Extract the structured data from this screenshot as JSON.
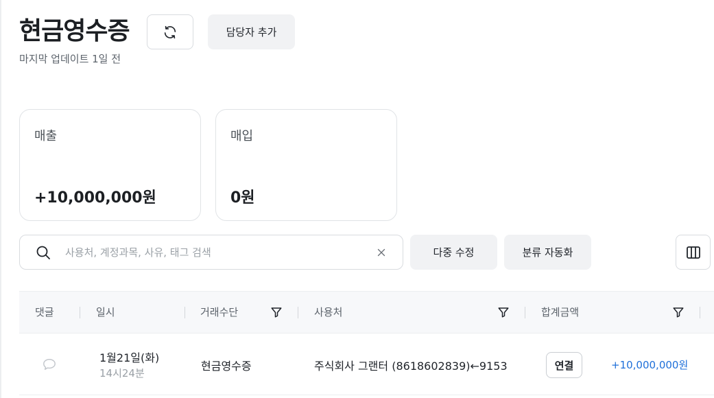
{
  "header": {
    "title": "현금영수증",
    "assign_label": "담당자 추가",
    "last_update": "마지막 업데이트 1일 전"
  },
  "summary": {
    "sales_label": "매출",
    "sales_value": "+10,000,000원",
    "purchase_label": "매입",
    "purchase_value": "0원"
  },
  "toolbar": {
    "search_placeholder": "사용처, 계정과목, 사유, 태그 검색",
    "search_value": "",
    "multi_edit_label": "다중 수정",
    "auto_classify_label": "분류 자동화"
  },
  "table": {
    "columns": [
      "댓글",
      "일시",
      "거래수단",
      "사용처",
      "합계금액"
    ],
    "rows": [
      {
        "date": "1월21일(화)",
        "time": "14시24분",
        "method": "현금영수증",
        "merchant": "주식회사 그랜터 (8618602839)←9153",
        "link_label": "연결",
        "amount": "+10,000,000원"
      }
    ]
  },
  "icons": {
    "refresh": "refresh-icon",
    "search": "search-icon",
    "clear": "close-icon",
    "columns": "columns-icon",
    "filter": "filter-icon",
    "comment": "comment-icon"
  },
  "colors": {
    "amount_positive": "#1e6fd9",
    "button_gray": "#f1f2f4",
    "border": "#d8dbdf"
  }
}
